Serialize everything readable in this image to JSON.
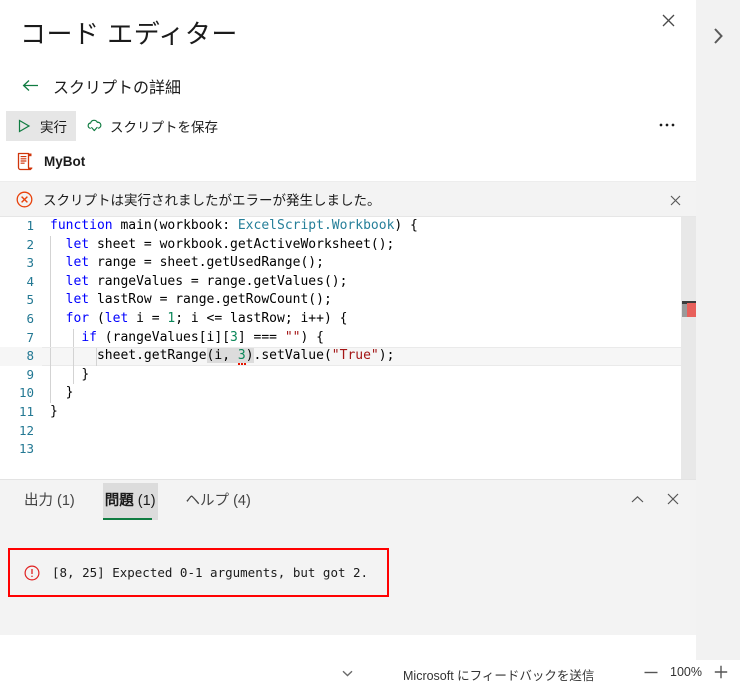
{
  "header": {
    "title": "コード エディター",
    "close_label": "✕",
    "expand_label": "❯"
  },
  "back_row": {
    "arrow": "←",
    "label": "スクリプトの詳細"
  },
  "command_bar": {
    "run_label": "実行",
    "save_label": "スクリプトを保存",
    "more_label": "•••"
  },
  "script": {
    "name": "MyBot"
  },
  "banner": {
    "message": "スクリプトは実行されましたがエラーが発生しました。",
    "close_label": "✕"
  },
  "editor": {
    "lines": [
      {
        "n": "1",
        "text": "function main(workbook: ExcelScript.Workbook) {"
      },
      {
        "n": "2",
        "text": "  let sheet = workbook.getActiveWorksheet();"
      },
      {
        "n": "3",
        "text": "  let range = sheet.getUsedRange();"
      },
      {
        "n": "4",
        "text": "  let rangeValues = range.getValues();"
      },
      {
        "n": "5",
        "text": "  let lastRow = range.getRowCount();"
      },
      {
        "n": "6",
        "text": "  for (let i = 1; i <= lastRow; i++) {"
      },
      {
        "n": "7",
        "text": "    if (rangeValues[i][3] === \"\") {"
      },
      {
        "n": "8",
        "text": "      sheet.getRange(i, 3).setValue(\"True\");"
      },
      {
        "n": "9",
        "text": "    }"
      },
      {
        "n": "10",
        "text": "  }"
      },
      {
        "n": "11",
        "text": "}"
      },
      {
        "n": "12",
        "text": ""
      },
      {
        "n": "13",
        "text": ""
      }
    ],
    "tokens": {
      "function": "function",
      "main": "main",
      "workbook_param": "(workbook: ",
      "excelscript": "ExcelScript.Workbook",
      "open_brace": ") {",
      "let": "let",
      "for": "for",
      "if": "if",
      "num_1": "1",
      "num_3": "3",
      "str_empty": "\"\"",
      "str_true": "\"True\"",
      "l2_rest": " sheet = workbook.getActiveWorksheet();",
      "l3_rest": " range = sheet.getUsedRange();",
      "l4_rest": " rangeValues = range.getValues();",
      "l5_rest": " lastRow = range.getRowCount();",
      "l6_a": " (",
      "l6_b": " i = ",
      "l6_c": "; i <= lastRow; i++) {",
      "l7_a": " (rangeValues[i][",
      "l7_b": "] === ",
      "l7_c": ") {",
      "l8_a": "sheet.getRange",
      "l8_b": "(i, ",
      "l8_c": ")",
      "l8_d": ".setValue(",
      "l8_e": ");",
      "l9": "}",
      "l10": "}",
      "l11": "}"
    },
    "colors": {
      "keyword": "#0000ff",
      "type": "#267f99",
      "number": "#098658",
      "string": "#a31515",
      "linenumber": "#237893",
      "error_marker": "#e8605b"
    }
  },
  "bottom_panel": {
    "tabs": [
      {
        "label": "出力",
        "count": "(1)",
        "selected": false
      },
      {
        "label": "問題",
        "count": "(1)",
        "selected": true
      },
      {
        "label": "ヘルプ",
        "count": "(4)",
        "selected": false
      }
    ],
    "collapse_label": "⌃",
    "close_label": "✕",
    "problem": {
      "icon": "!",
      "text": "[8, 25] Expected 0-1 arguments, but got 2.",
      "highlight_color": "#ff0000"
    }
  },
  "status_bar": {
    "caret": "⌄",
    "feedback": "Microsoft にフィードバックを送信",
    "zoom_out": "−",
    "zoom_level": "100%",
    "zoom_in": "＋"
  }
}
